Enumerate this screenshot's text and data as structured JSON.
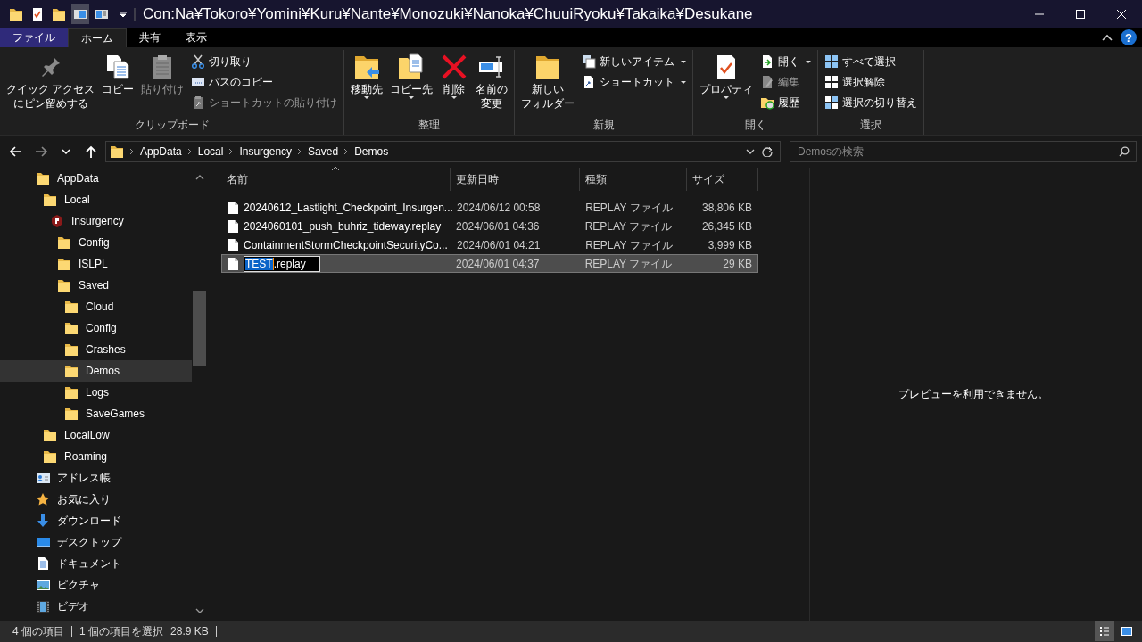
{
  "window": {
    "title": "Con:Na¥Tokoro¥Yomini¥Kuru¥Nante¥Monozuki¥Nanoka¥ChuuiRyoku¥Takaika¥Desukane"
  },
  "ribbon_tabs": [
    {
      "label": "ファイル",
      "kind": "file",
      "selected": false
    },
    {
      "label": "ホーム",
      "kind": "tab",
      "selected": true
    },
    {
      "label": "共有",
      "kind": "tab",
      "selected": false
    },
    {
      "label": "表示",
      "kind": "tab",
      "selected": false
    }
  ],
  "help": "?",
  "ribbon_groups": [
    {
      "label": "クリップボード",
      "commands": [
        {
          "lines": [
            "クイック アクセス",
            "にピン留めする"
          ],
          "kind": "large",
          "disabled": false,
          "dropdown": false
        },
        {
          "lines": [
            "コピー"
          ],
          "kind": "large",
          "disabled": false,
          "dropdown": false
        },
        {
          "lines": [
            "貼り付け"
          ],
          "kind": "large",
          "disabled": true,
          "dropdown": false
        },
        {
          "label": "切り取り",
          "kind": "small",
          "disabled": false,
          "dropdown": false
        },
        {
          "label": "パスのコピー",
          "kind": "small",
          "disabled": false,
          "dropdown": false
        },
        {
          "label": "ショートカットの貼り付け",
          "kind": "small",
          "disabled": true,
          "dropdown": false
        }
      ]
    },
    {
      "label": "整理",
      "commands": [
        {
          "lines": [
            "移動先"
          ],
          "kind": "large",
          "disabled": false,
          "dropdown": true
        },
        {
          "lines": [
            "コピー先"
          ],
          "kind": "large",
          "disabled": false,
          "dropdown": true
        },
        {
          "lines": [
            "削除"
          ],
          "kind": "large",
          "disabled": false,
          "dropdown": true
        },
        {
          "lines": [
            "名前の",
            "変更"
          ],
          "kind": "large",
          "disabled": false,
          "dropdown": false
        }
      ]
    },
    {
      "label": "新規",
      "commands": [
        {
          "lines": [
            "新しい",
            "フォルダー"
          ],
          "kind": "large",
          "disabled": false,
          "dropdown": false
        },
        {
          "label": "新しいアイテム",
          "kind": "small",
          "disabled": false,
          "dropdown": true
        },
        {
          "label": "ショートカット",
          "kind": "small",
          "disabled": false,
          "dropdown": true
        }
      ]
    },
    {
      "label": "開く",
      "commands": [
        {
          "lines": [
            "プロパティ"
          ],
          "kind": "large",
          "disabled": false,
          "dropdown": true
        },
        {
          "label": "開く",
          "kind": "small",
          "disabled": false,
          "dropdown": true
        },
        {
          "label": "編集",
          "kind": "small",
          "disabled": true,
          "dropdown": false
        },
        {
          "label": "履歴",
          "kind": "small",
          "disabled": false,
          "dropdown": false
        }
      ]
    },
    {
      "label": "選択",
      "commands": [
        {
          "label": "すべて選択",
          "kind": "small",
          "disabled": false,
          "dropdown": false
        },
        {
          "label": "選択解除",
          "kind": "small",
          "disabled": false,
          "dropdown": false
        },
        {
          "label": "選択の切り替え",
          "kind": "small",
          "disabled": false,
          "dropdown": false
        }
      ]
    }
  ],
  "address": {
    "breadcrumbs": [
      "AppData",
      "Local",
      "Insurgency",
      "Saved",
      "Demos"
    ]
  },
  "search": {
    "placeholder": "Demosの検索"
  },
  "tree": [
    {
      "label": "AppData",
      "kind": "folder",
      "selected": false,
      "children": [
        {
          "label": "Local",
          "kind": "folder",
          "selected": false,
          "children": [
            {
              "label": "Insurgency",
              "kind": "app",
              "selected": false,
              "children": [
                {
                  "label": "Config",
                  "kind": "folder",
                  "selected": false
                },
                {
                  "label": "ISLPL",
                  "kind": "folder",
                  "selected": false
                },
                {
                  "label": "Saved",
                  "kind": "folder",
                  "selected": false,
                  "children": [
                    {
                      "label": "Cloud",
                      "kind": "folder",
                      "selected": false
                    },
                    {
                      "label": "Config",
                      "kind": "folder",
                      "selected": false
                    },
                    {
                      "label": "Crashes",
                      "kind": "folder",
                      "selected": false
                    },
                    {
                      "label": "Demos",
                      "kind": "folder",
                      "selected": true
                    },
                    {
                      "label": "Logs",
                      "kind": "folder",
                      "selected": false
                    },
                    {
                      "label": "SaveGames",
                      "kind": "folder",
                      "selected": false
                    }
                  ]
                }
              ]
            }
          ]
        },
        {
          "label": "LocalLow",
          "kind": "folder",
          "selected": false
        },
        {
          "label": "Roaming",
          "kind": "folder",
          "selected": false
        }
      ]
    },
    {
      "label": "アドレス帳",
      "kind": "contacts",
      "selected": false
    },
    {
      "label": "お気に入り",
      "kind": "favorites",
      "selected": false
    },
    {
      "label": "ダウンロード",
      "kind": "downloads",
      "selected": false
    },
    {
      "label": "デスクトップ",
      "kind": "desktop",
      "selected": false
    },
    {
      "label": "ドキュメント",
      "kind": "documents",
      "selected": false
    },
    {
      "label": "ピクチャ",
      "kind": "pictures",
      "selected": false
    },
    {
      "label": "ビデオ",
      "kind": "videos",
      "selected": false
    }
  ],
  "table": {
    "columns": [
      {
        "label": "名前",
        "sorted": true
      },
      {
        "label": "更新日時",
        "sorted": false
      },
      {
        "label": "種類",
        "sorted": false
      },
      {
        "label": "サイズ",
        "sorted": false
      }
    ],
    "rows": [
      {
        "name": "20240612_Lastlight_Checkpoint_Insurgen...",
        "modified": "2024/06/12 00:58",
        "type": "REPLAY ファイル",
        "size": "38,806 KB",
        "selected": false,
        "renaming": false
      },
      {
        "name": "2024060101_push_buhriz_tideway.replay",
        "modified": "2024/06/01 04:36",
        "type": "REPLAY ファイル",
        "size": "26,345 KB",
        "selected": false,
        "renaming": false
      },
      {
        "name": "ContainmentStormCheckpointSecurityCo...",
        "modified": "2024/06/01 04:21",
        "type": "REPLAY ファイル",
        "size": "3,999 KB",
        "selected": false,
        "renaming": false
      },
      {
        "name": "TEST.replay",
        "modified": "2024/06/01 04:37",
        "type": "REPLAY ファイル",
        "size": "29 KB",
        "selected": true,
        "renaming": true
      }
    ]
  },
  "preview": {
    "message": "プレビューを利用できません。"
  },
  "status_bar": {
    "items": [
      "4 個の項目",
      "1 個の項目を選択",
      "28.9 KB"
    ],
    "views": [
      {
        "kind": "details",
        "selected": true
      },
      {
        "kind": "large_icons",
        "selected": false
      }
    ]
  }
}
